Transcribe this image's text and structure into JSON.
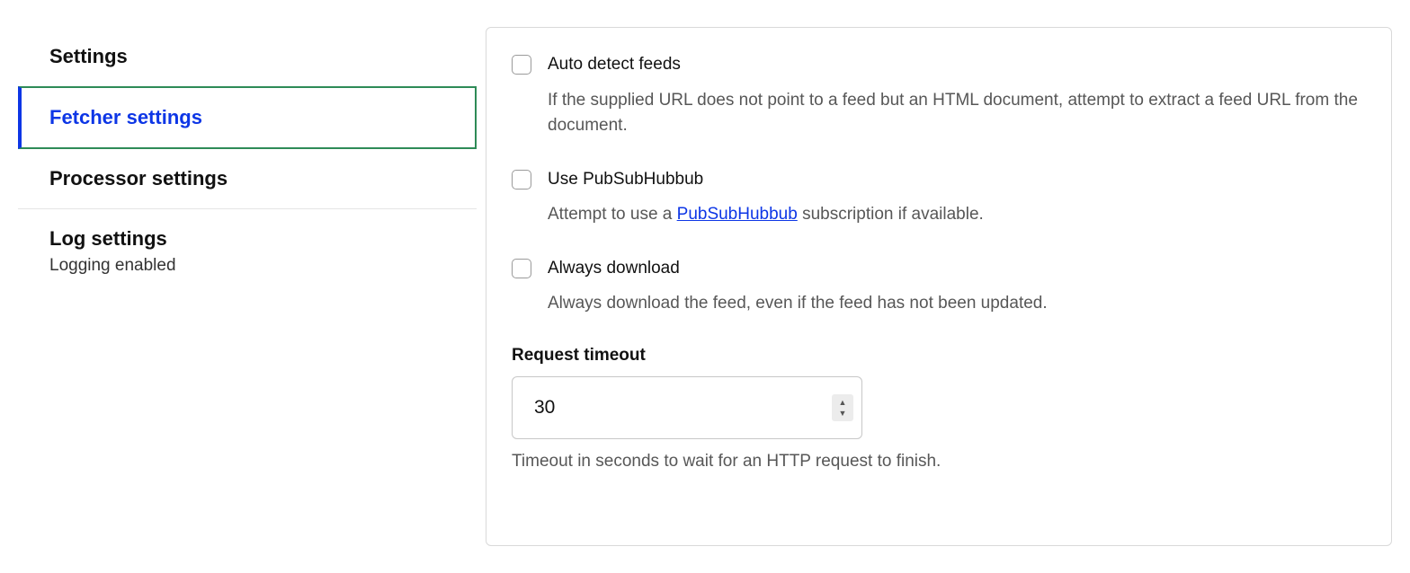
{
  "sidebar": {
    "items": [
      {
        "label": "Settings"
      },
      {
        "label": "Fetcher settings"
      },
      {
        "label": "Processor settings"
      },
      {
        "label": "Log settings",
        "sub": "Logging enabled"
      }
    ]
  },
  "panel": {
    "autoDetect": {
      "label": "Auto detect feeds",
      "desc": "If the supplied URL does not point to a feed but an HTML document, attempt to extract a feed URL from the document."
    },
    "pubSub": {
      "label": "Use PubSubHubbub",
      "desc_prefix": "Attempt to use a ",
      "link": "PubSubHubbub",
      "desc_suffix": " subscription if available."
    },
    "alwaysDownload": {
      "label": "Always download",
      "desc": "Always download the feed, even if the feed has not been updated."
    },
    "timeout": {
      "title": "Request timeout",
      "value": "30",
      "desc": "Timeout in seconds to wait for an HTTP request to finish."
    }
  }
}
